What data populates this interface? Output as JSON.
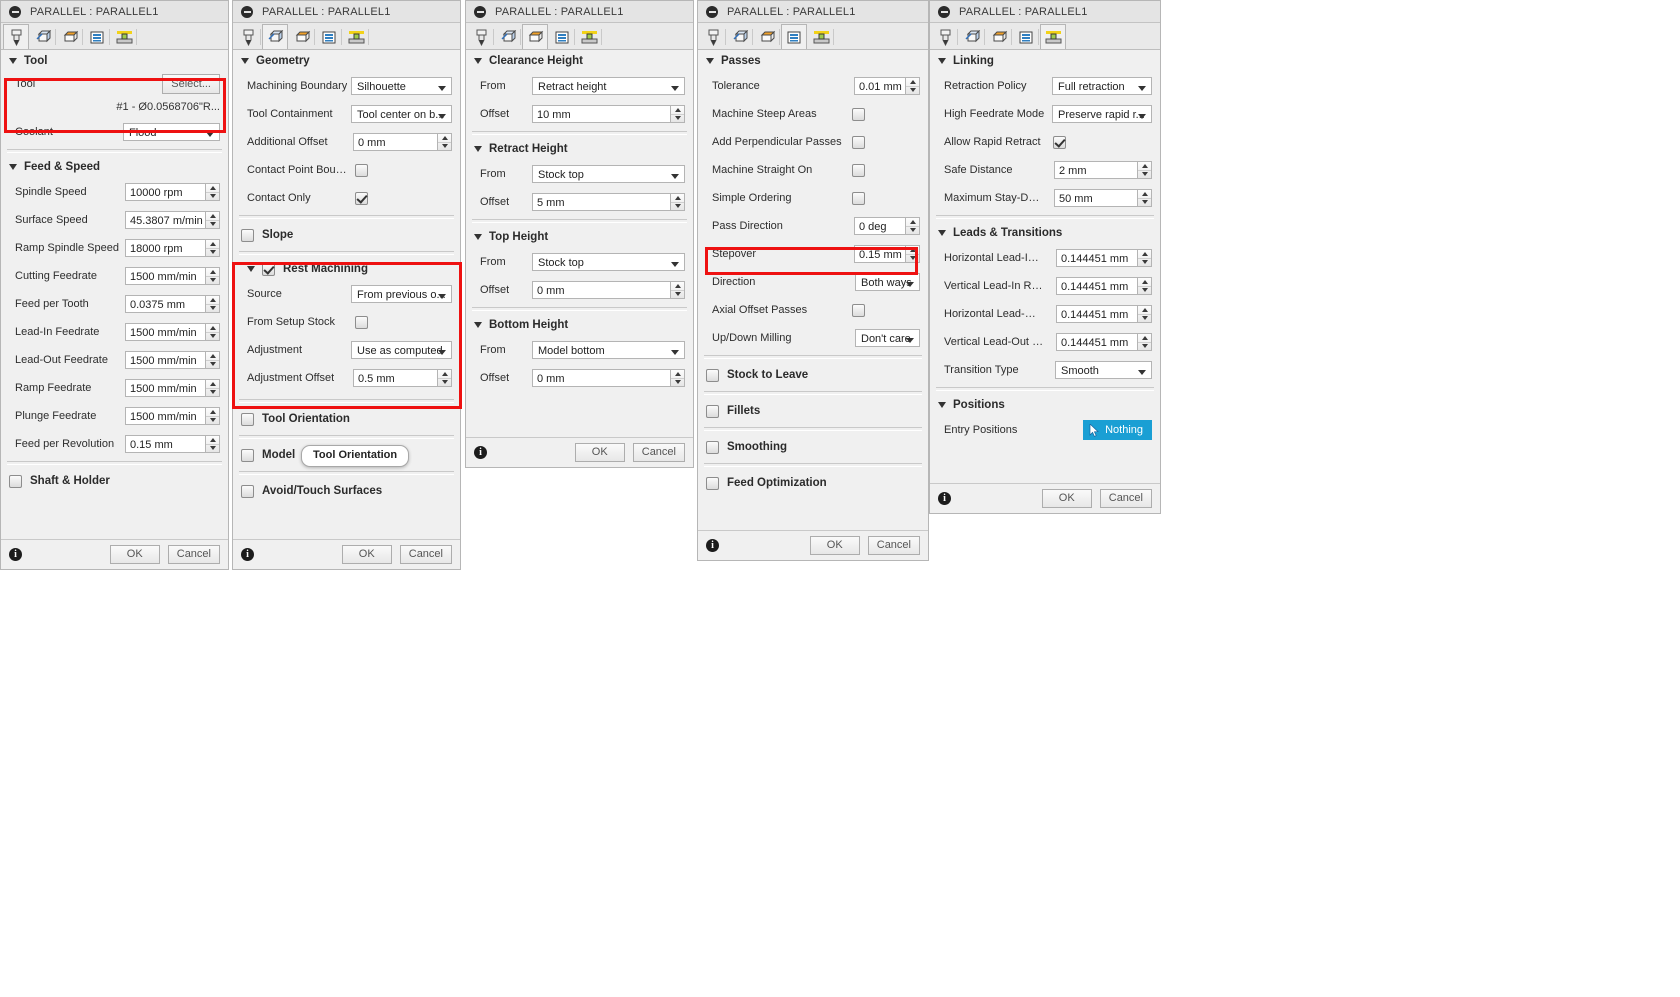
{
  "window_title": "PARALLEL : PARALLEL1",
  "tabs": [
    "tool-tab-icon",
    "geometry-tab-icon",
    "heights-tab-icon",
    "passes-tab-icon",
    "linking-tab-icon"
  ],
  "buttons": {
    "ok": "OK",
    "cancel": "Cancel",
    "select": "Select..."
  },
  "panel_tool": {
    "title": "PARALLEL : PARALLEL1",
    "group_tool": "Tool",
    "tool_label": "Tool",
    "tool_value": "#1 - Ø0.0568706\"R...",
    "coolant_label": "Coolant",
    "coolant_value": "Flood",
    "group_feed": "Feed & Speed",
    "rows": [
      {
        "label": "Spindle Speed",
        "value": "10000 rpm"
      },
      {
        "label": "Surface Speed",
        "value": "45.3807 m/min"
      },
      {
        "label": "Ramp Spindle Speed",
        "value": "18000 rpm"
      },
      {
        "label": "Cutting Feedrate",
        "value": "1500 mm/min"
      },
      {
        "label": "Feed per Tooth",
        "value": "0.0375 mm"
      },
      {
        "label": "Lead-In Feedrate",
        "value": "1500 mm/min"
      },
      {
        "label": "Lead-Out Feedrate",
        "value": "1500 mm/min"
      },
      {
        "label": "Ramp Feedrate",
        "value": "1500 mm/min"
      },
      {
        "label": "Plunge Feedrate",
        "value": "1500 mm/min"
      },
      {
        "label": "Feed per Revolution",
        "value": "0.15 mm"
      }
    ],
    "shaft_holder": "Shaft & Holder"
  },
  "panel_geometry": {
    "title": "PARALLEL : PARALLEL1",
    "group_geometry": "Geometry",
    "machining_boundary_label": "Machining Boundary",
    "machining_boundary_value": "Silhouette",
    "tool_containment_label": "Tool Containment",
    "tool_containment_value": "Tool center on b...",
    "additional_offset_label": "Additional Offset",
    "additional_offset_value": "0 mm",
    "contact_point_label": "Contact Point Boundi...",
    "contact_only_label": "Contact Only",
    "slope": "Slope",
    "rest_machining": "Rest Machining",
    "source_label": "Source",
    "source_value": "From previous o...",
    "from_setup_stock_label": "From Setup Stock",
    "adjustment_label": "Adjustment",
    "adjustment_value": "Use as computed",
    "adjustment_offset_label": "Adjustment Offset",
    "adjustment_offset_value": "0.5 mm",
    "tool_orientation": "Tool Orientation",
    "model": "Model",
    "avoid_touch": "Avoid/Touch Surfaces",
    "tooltip": "Tool Orientation"
  },
  "panel_heights": {
    "title": "PARALLEL : PARALLEL1",
    "groups": [
      {
        "name": "Clearance Height",
        "from_label": "From",
        "from_value": "Retract height",
        "offset_label": "Offset",
        "offset_value": "10 mm"
      },
      {
        "name": "Retract Height",
        "from_label": "From",
        "from_value": "Stock top",
        "offset_label": "Offset",
        "offset_value": "5 mm"
      },
      {
        "name": "Top Height",
        "from_label": "From",
        "from_value": "Stock top",
        "offset_label": "Offset",
        "offset_value": "0 mm"
      },
      {
        "name": "Bottom Height",
        "from_label": "From",
        "from_value": "Model bottom",
        "offset_label": "Offset",
        "offset_value": "0 mm"
      }
    ]
  },
  "panel_passes": {
    "title": "PARALLEL : PARALLEL1",
    "group_passes": "Passes",
    "tolerance_label": "Tolerance",
    "tolerance_value": "0.01 mm",
    "machine_steep_label": "Machine Steep Areas",
    "add_perp_label": "Add Perpendicular Passes",
    "machine_straight_label": "Machine Straight On",
    "simple_ordering_label": "Simple Ordering",
    "pass_direction_label": "Pass Direction",
    "pass_direction_value": "0 deg",
    "stepover_label": "Stepover",
    "stepover_value": "0.15 mm",
    "direction_label": "Direction",
    "direction_value": "Both ways",
    "axial_offset_label": "Axial Offset Passes",
    "updown_label": "Up/Down Milling",
    "updown_value": "Don't care",
    "stock_to_leave": "Stock to Leave",
    "fillets": "Fillets",
    "smoothing": "Smoothing",
    "feed_optimization": "Feed Optimization"
  },
  "panel_linking": {
    "title": "PARALLEL : PARALLEL1",
    "group_linking": "Linking",
    "retraction_policy_label": "Retraction Policy",
    "retraction_policy_value": "Full retraction",
    "high_feedrate_label": "High Feedrate Mode",
    "high_feedrate_value": "Preserve rapid r...",
    "allow_rapid_label": "Allow Rapid Retract",
    "safe_distance_label": "Safe Distance",
    "safe_distance_value": "2 mm",
    "max_staydown_label": "Maximum Stay-Dowr...",
    "max_staydown_value": "50 mm",
    "group_leads": "Leads & Transitions",
    "leads": [
      {
        "label": "Horizontal Lead-In Ri...",
        "value": "0.144451 mm"
      },
      {
        "label": "Vertical Lead-In Radi...",
        "value": "0.144451 mm"
      },
      {
        "label": "Horizontal Lead-Out ...",
        "value": "0.144451 mm"
      },
      {
        "label": "Vertical Lead-Out Ra...",
        "value": "0.144451 mm"
      }
    ],
    "transition_type_label": "Transition Type",
    "transition_type_value": "Smooth",
    "group_positions": "Positions",
    "entry_positions_label": "Entry Positions",
    "entry_positions_value": "Nothing"
  },
  "highlight_color": "#ee1111"
}
